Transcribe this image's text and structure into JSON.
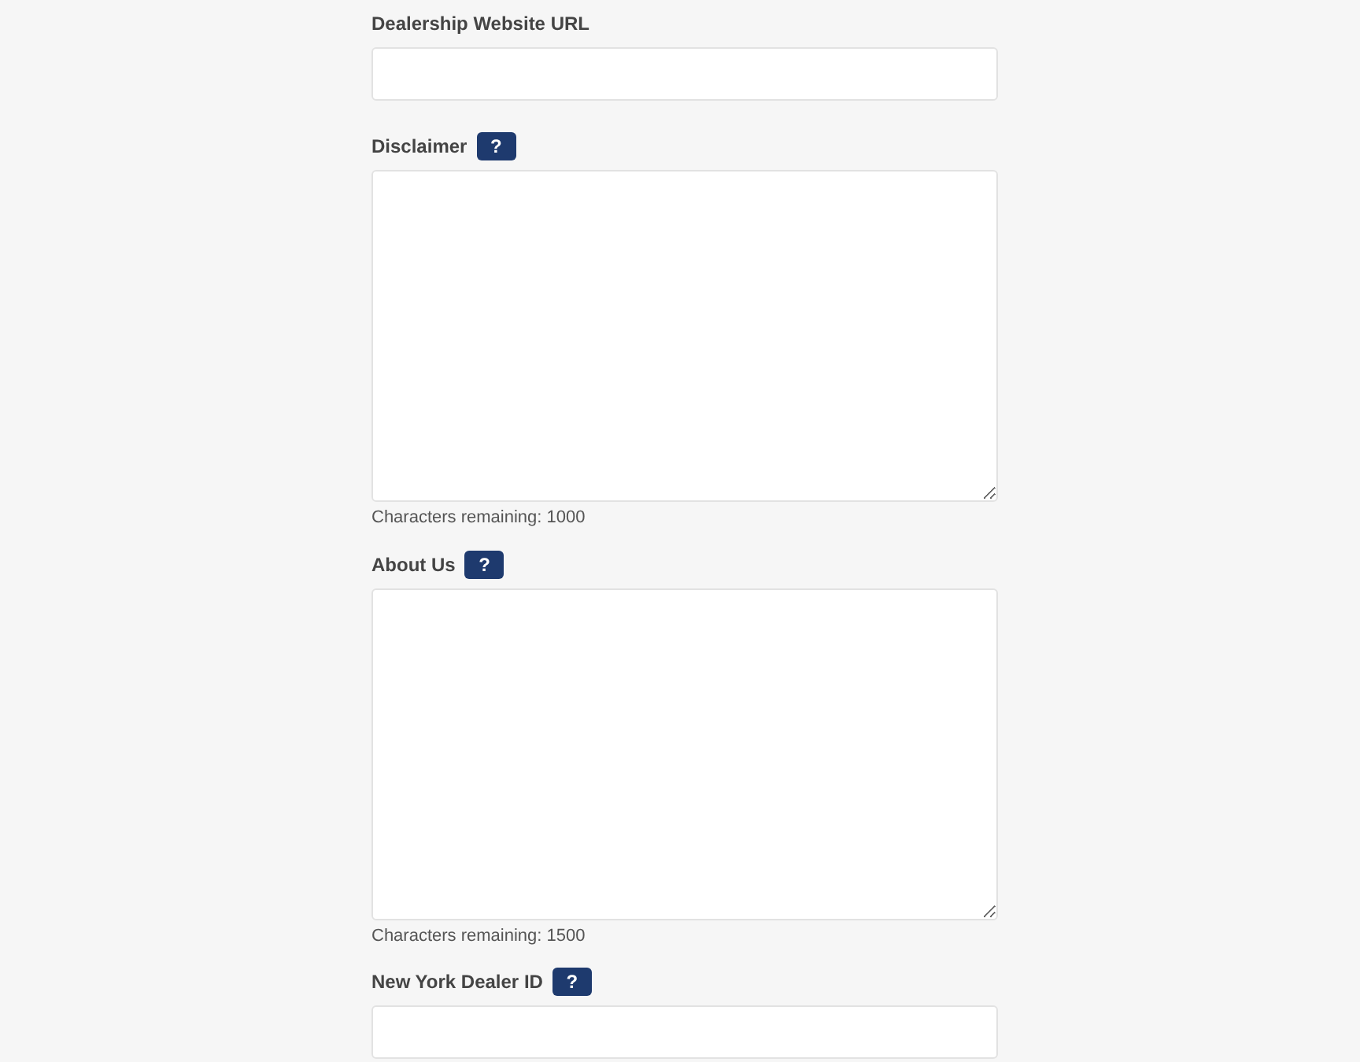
{
  "fields": [
    {
      "kind": "input",
      "label": "Dealership Website URL"
    },
    {
      "kind": "textarea",
      "label": "Disclaimer",
      "help": "?",
      "counter": "Characters remaining: 1000"
    },
    {
      "kind": "textarea",
      "label": "About Us",
      "help": "?",
      "counter": "Characters remaining: 1500"
    },
    {
      "kind": "input",
      "label": "New York Dealer ID",
      "help": "?"
    }
  ]
}
